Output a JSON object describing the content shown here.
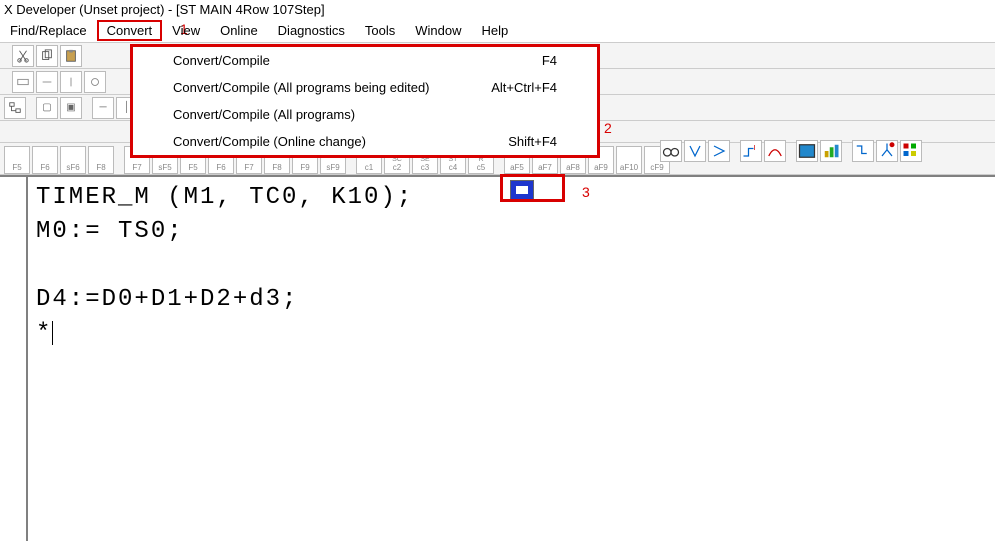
{
  "title": "X Developer (Unset project) - [ST MAIN  4Row 107Step]",
  "menubar": {
    "items": [
      {
        "label": "Find/Replace"
      },
      {
        "label": "Convert",
        "active": true
      },
      {
        "label": "View"
      },
      {
        "label": "Online"
      },
      {
        "label": "Diagnostics"
      },
      {
        "label": "Tools"
      },
      {
        "label": "Window"
      },
      {
        "label": "Help"
      }
    ]
  },
  "annotations": {
    "a1": "1",
    "a2": "2",
    "a3": "3"
  },
  "dropdown": {
    "rows": [
      {
        "label": "Convert/Compile",
        "shortcut": "F4"
      },
      {
        "label": "Convert/Compile (All programs being edited)",
        "shortcut": "Alt+Ctrl+F4"
      },
      {
        "label": "Convert/Compile (All programs)",
        "shortcut": ""
      },
      {
        "label": "Convert/Compile (Online change)",
        "shortcut": "Shift+F4"
      }
    ]
  },
  "toolbar1_icons": [
    "cut-icon",
    "copy-icon",
    "paste-icon"
  ],
  "toolbar2_fkeys": [
    "F5",
    "F6",
    "F7",
    "F8",
    "F7",
    "F8",
    "F7",
    "F8",
    "F5",
    "F9",
    "F10",
    "F10",
    "aF9",
    "aF9"
  ],
  "row2_right_icons": [
    "binoculars-icon",
    "arrow-down-icon",
    "arrow-right-icon",
    "step-icon",
    "arc-icon",
    "window-icon",
    "chart-icon",
    "down-step-icon",
    "split-icon",
    "color-icon"
  ],
  "toolbar3_icons": [
    "tree-icon",
    "box-icon",
    "box2-icon",
    "hline-icon",
    "vline-icon",
    "l1-icon",
    "l2-icon",
    "l3-icon",
    "l4-icon",
    "grid-icon",
    "grid2-icon",
    "pal1-icon",
    "pal2-icon",
    "corner-icon",
    "corner2-icon",
    "globe-icon",
    "align1-icon",
    "align2-icon",
    "align3-icon",
    "highlighted-icon"
  ],
  "fkeys_row": [
    {
      "top": "",
      "bot": "F5"
    },
    {
      "top": "",
      "bot": "F6"
    },
    {
      "top": "",
      "bot": "sF6"
    },
    {
      "top": "",
      "bot": "F8"
    },
    {
      "top": "",
      "bot": "F7"
    },
    {
      "top": "",
      "bot": "sF5"
    },
    {
      "top": "",
      "bot": "F5"
    },
    {
      "top": "",
      "bot": "F6"
    },
    {
      "top": "",
      "bot": "F7"
    },
    {
      "top": "",
      "bot": "F8"
    },
    {
      "top": "",
      "bot": "F9"
    },
    {
      "top": "",
      "bot": "sF9"
    },
    {
      "top": "",
      "bot": "c1"
    },
    {
      "top": "SC",
      "bot": "c2"
    },
    {
      "top": "SE",
      "bot": "c3"
    },
    {
      "top": "ST",
      "bot": "c4"
    },
    {
      "top": "R",
      "bot": "c5"
    },
    {
      "top": "",
      "bot": "aF5"
    },
    {
      "top": "",
      "bot": "aF7"
    },
    {
      "top": "",
      "bot": "aF8"
    },
    {
      "top": "",
      "bot": "aF9"
    },
    {
      "top": "",
      "bot": "aF10"
    },
    {
      "top": "",
      "bot": "cF9"
    }
  ],
  "code_lines": [
    "TIMER_M (M1, TC0, K10);",
    "M0:= TS0;",
    "",
    "D4:=D0+D1+D2+d3;",
    "*"
  ]
}
